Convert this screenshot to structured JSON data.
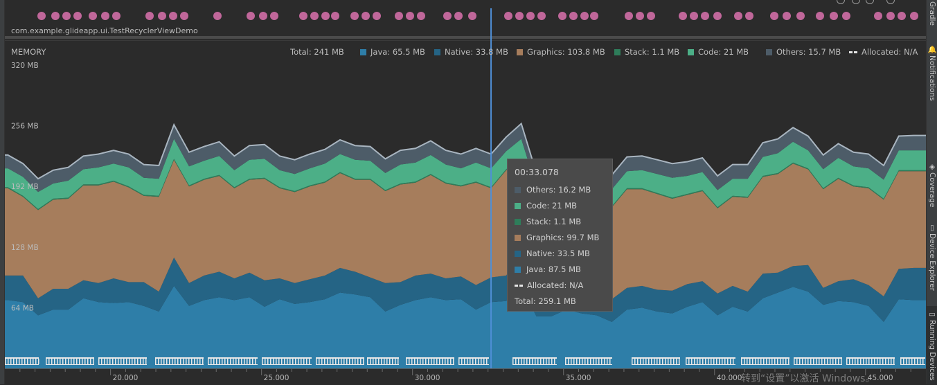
{
  "app": {
    "process_name": "com.example.glideapp.ui.TestRecyclerViewDemo"
  },
  "memory": {
    "title": "MEMORY",
    "legend": {
      "total": "Total: 241 MB",
      "java": "Java: 65.5 MB",
      "native": "Native: 33.8 MB",
      "graphics": "Graphics: 103.8 MB",
      "stack": "Stack: 1.1 MB",
      "code": "Code: 21 MB",
      "others": "Others: 15.7 MB",
      "allocated": "Allocated: N/A"
    },
    "colors": {
      "java": "#2e7ea8",
      "native": "#256485",
      "graphics": "#a67d5c",
      "stack": "#2e7d5a",
      "code": "#4caf87",
      "others": "#4d5c68",
      "total_line": "#a9b5c0",
      "cursor": "#4f8fd6",
      "event_dot": "#c0679a"
    }
  },
  "chart_data": {
    "type": "area",
    "stacked": true,
    "y_ticks": [
      "320 MB",
      "256 MB",
      "192 MB",
      "128 MB",
      "64 MB"
    ],
    "ylim": [
      0,
      320
    ],
    "x_ticks": [
      "20.000",
      "25.000",
      "30.000",
      "35.000",
      "40.000",
      "45.000"
    ],
    "xlim": [
      16.5,
      47
    ],
    "x": [
      16.6,
      17.1,
      17.6,
      18.1,
      18.6,
      19.1,
      19.6,
      20.1,
      20.6,
      21.1,
      21.6,
      22.1,
      22.6,
      23.1,
      23.6,
      24.1,
      24.6,
      25.1,
      25.6,
      26.1,
      26.6,
      27.1,
      27.6,
      28.1,
      28.6,
      29.1,
      29.6,
      30.1,
      30.6,
      31.1,
      31.6,
      32.1,
      32.6,
      33.1,
      33.6,
      34.1,
      34.6,
      35.1,
      35.6,
      36.1,
      36.6,
      37.1,
      37.6,
      38.1,
      38.6,
      39.1,
      39.6,
      40.1,
      40.6,
      41.1,
      41.6,
      42.1,
      42.6,
      43.1,
      43.6,
      44.1,
      44.6,
      45.1,
      45.6,
      46.1,
      46.6
    ],
    "series": [
      {
        "name": "Java",
        "values": [
          72,
          70,
          56,
          62,
          62,
          74,
          70,
          69,
          70,
          66,
          60,
          87,
          66,
          72,
          75,
          72,
          75,
          65,
          73,
          68,
          70,
          73,
          80,
          78,
          75,
          60,
          67,
          72,
          75,
          72,
          73,
          62,
          70,
          71,
          87,
          55,
          55,
          62,
          58,
          56,
          49,
          62,
          64,
          60,
          58,
          65,
          70,
          56,
          65,
          60,
          74,
          80,
          86,
          81,
          67,
          71,
          70,
          66,
          49,
          73,
          72
        ]
      },
      {
        "name": "Native",
        "values": [
          26,
          28,
          18,
          22,
          22,
          19,
          20,
          26,
          21,
          25,
          21,
          30,
          24,
          26,
          27,
          23,
          26,
          28,
          22,
          22,
          24,
          25,
          26,
          24,
          21,
          30,
          24,
          26,
          25,
          23,
          24,
          26,
          26,
          27,
          33,
          24,
          24,
          26,
          20,
          25,
          24,
          23,
          23,
          23,
          24,
          24,
          22,
          23,
          22,
          21,
          26,
          21,
          22,
          28,
          18,
          21,
          24,
          22,
          27,
          32,
          34
        ]
      },
      {
        "name": "Graphics",
        "values": [
          92,
          83,
          93,
          94,
          95,
          100,
          103,
          102,
          100,
          91,
          100,
          103,
          102,
          101,
          101,
          95,
          98,
          107,
          95,
          96,
          98,
          98,
          100,
          97,
          103,
          97,
          103,
          98,
          104,
          100,
          95,
          108,
          94,
          111,
          100,
          93,
          95,
          93,
          99,
          94,
          97,
          104,
          102,
          101,
          97,
          94,
          95,
          90,
          94,
          99,
          102,
          104,
          108,
          101,
          104,
          108,
          98,
          102,
          102,
          103,
          102
        ]
      },
      {
        "name": "Stack",
        "values": [
          1.1,
          1.1,
          1.1,
          1.1,
          1.1,
          1.1,
          1.1,
          1.1,
          1.1,
          1.1,
          1.1,
          1.1,
          1.1,
          1.1,
          1.1,
          1.1,
          1.1,
          1.1,
          1.1,
          1.1,
          1.1,
          1.1,
          1.1,
          1.1,
          1.1,
          1.1,
          1.1,
          1.1,
          1.1,
          1.1,
          1.1,
          1.1,
          1.1,
          1.1,
          1.1,
          1.1,
          1.1,
          1.1,
          1.1,
          1.1,
          1.1,
          1.1,
          1.1,
          1.1,
          1.1,
          1.1,
          1.1,
          1.1,
          1.1,
          1.1,
          1.1,
          1.1,
          1.1,
          1.1,
          1.1,
          1.1,
          1.1,
          1.1,
          1.1,
          1.1,
          1.1
        ]
      },
      {
        "name": "Code",
        "values": [
          20,
          20,
          18,
          16,
          18,
          16,
          18,
          18,
          20,
          18,
          18,
          21,
          20,
          19,
          20,
          18,
          20,
          20,
          18,
          18,
          18,
          19,
          19,
          20,
          19,
          18,
          20,
          20,
          20,
          19,
          18,
          20,
          20,
          19,
          21,
          18,
          17,
          19,
          18,
          19,
          18,
          18,
          19,
          20,
          21,
          19,
          19,
          18,
          18,
          19,
          20,
          21,
          22,
          19,
          20,
          21,
          20,
          20,
          20,
          21,
          21
        ]
      },
      {
        "name": "Others",
        "values": [
          14,
          14,
          14,
          14,
          14,
          14,
          14,
          14,
          14,
          14,
          14,
          15,
          15,
          15,
          15,
          15,
          15,
          15,
          15,
          15,
          15,
          15,
          15,
          15,
          15,
          15,
          15,
          15,
          15,
          15,
          15,
          15,
          15,
          15,
          16.2,
          15,
          15,
          15,
          15,
          15,
          15,
          15,
          15,
          15,
          15,
          15,
          15,
          15,
          15,
          15,
          15,
          15,
          15,
          15,
          15,
          15,
          15,
          15,
          15,
          15,
          15.7
        ]
      }
    ]
  },
  "cursor": {
    "time": "00:33.078",
    "x": 32.6
  },
  "tooltip": {
    "time": "00:33.078",
    "others": "Others: 16.2 MB",
    "code": "Code: 21 MB",
    "stack": "Stack: 1.1 MB",
    "graphics": "Graphics: 99.7 MB",
    "native": "Native: 33.5 MB",
    "java": "Java: 87.5 MB",
    "allocated": "Allocated: N/A",
    "total": "Total: 259.1 MB"
  },
  "side_tabs": {
    "gradle": "Gradle",
    "notifications": "Notifications",
    "coverage": "Coverage",
    "device_explorer": "Device Explorer",
    "running_devices": "Running Devices"
  },
  "watermark": {
    "line1": "转到“设置”以激活 Windows。"
  }
}
